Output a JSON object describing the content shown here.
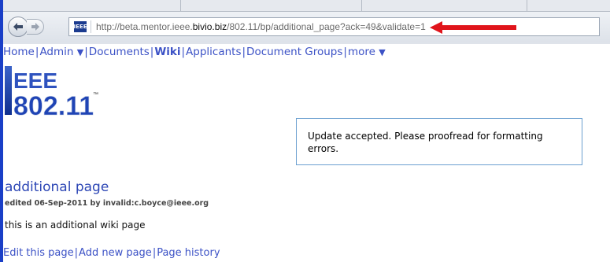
{
  "browser": {
    "url_prefix": "http://beta.mentor.ieee.",
    "url_domain": "bivio.biz",
    "url_suffix": "/802.11/bp/additional_page?ack=49&validate=1",
    "site_icon_text": "IEEE"
  },
  "nav": {
    "items": [
      {
        "label": "Home"
      },
      {
        "label": "Admin",
        "caret": "▼"
      },
      {
        "label": "Documents"
      },
      {
        "label": "Wiki"
      },
      {
        "label": "Applicants"
      },
      {
        "label": "Document Groups"
      },
      {
        "label": "more",
        "caret": "▼"
      }
    ],
    "separator": "|"
  },
  "logo": {
    "line1": "EEE",
    "line2": "802.11",
    "tm": "™"
  },
  "notice": {
    "message": "Update accepted. Please proofread for formatting errors."
  },
  "page": {
    "title": "additional page",
    "edited": "edited 06-Sep-2011 by invalid:c.boyce@ieee.org",
    "body": "this is an additional wiki page"
  },
  "footer": {
    "edit_link": "Edit this page",
    "add_link": "Add new page",
    "history_link": "Page history"
  },
  "colors": {
    "link": "#3c52c6",
    "arrow": "#e0141b",
    "notice_border": "#6a9fd0"
  }
}
